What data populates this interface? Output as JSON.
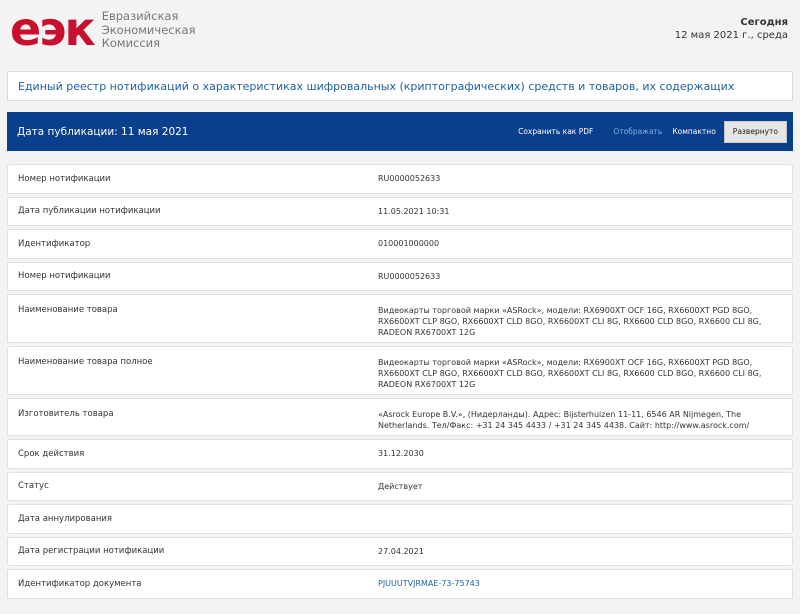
{
  "header": {
    "logo_mark": "еэк",
    "logo_lines": [
      "Евразийская",
      "Экономическая",
      "Комиссия"
    ],
    "today_label": "Сегодня",
    "today_date": "12 мая 2021 г., среда"
  },
  "title": "Единый реестр нотификаций о характеристиках шифровальных (криптографических) средств и товаров, их содержащих",
  "pubbar": {
    "publication_date": "Дата публикации: 11 мая 2021",
    "save_pdf": "Сохранить как PDF",
    "show_label": "Отображать",
    "compact": "Компактно",
    "expanded": "Развернуто"
  },
  "rows": [
    {
      "label": "Номер нотификации",
      "value": "RU0000052633"
    },
    {
      "label": "Дата публикации нотификации",
      "value": "11.05.2021 10:31"
    },
    {
      "label": "Идентификатор",
      "value": "010001000000"
    },
    {
      "label": "Номер нотификации",
      "value": "RU0000052633"
    },
    {
      "label": "Наименование товара",
      "value": "Видеокарты торговой марки «ASRock», модели: RX6900XT OCF 16G, RX6600XT PGD 8GO, RX6600XT CLP 8GO, RX6600XT CLD 8GO, RX6600XT CLI 8G, RX6600 CLD 8GO, RX6600 CLI 8G, RADEON RX6700XT 12G"
    },
    {
      "label": "Наименование товара полное",
      "value": "Видеокарты торговой марки «ASRock», модели: RX6900XT OCF 16G, RX6600XT PGD 8GO, RX6600XT CLP 8GO, RX6600XT CLD 8GO, RX6600XT CLI 8G, RX6600 CLD 8GO, RX6600 CLI 8G, RADEON RX6700XT 12G"
    },
    {
      "label": "Изготовитель товара",
      "value": "«Asrock Europe B.V.», (Нидерланды). Адрес: Bijsterhuizen 11-11, 6546 AR Nijmegen, The Netherlands. Тел/Факс: +31 24 345 4433 / +31 24 345 4438. Сайт: http://www.asrock.com/"
    },
    {
      "label": "Срок действия",
      "value": "31.12.2030"
    },
    {
      "label": "Статус",
      "value": "Действует"
    },
    {
      "label": "Дата аннулирования",
      "value": ""
    },
    {
      "label": "Дата регистрации нотификации",
      "value": "27.04.2021"
    },
    {
      "label": "Идентификатор документа",
      "value": "PJUUUTVJRMAE-73-75743"
    }
  ]
}
